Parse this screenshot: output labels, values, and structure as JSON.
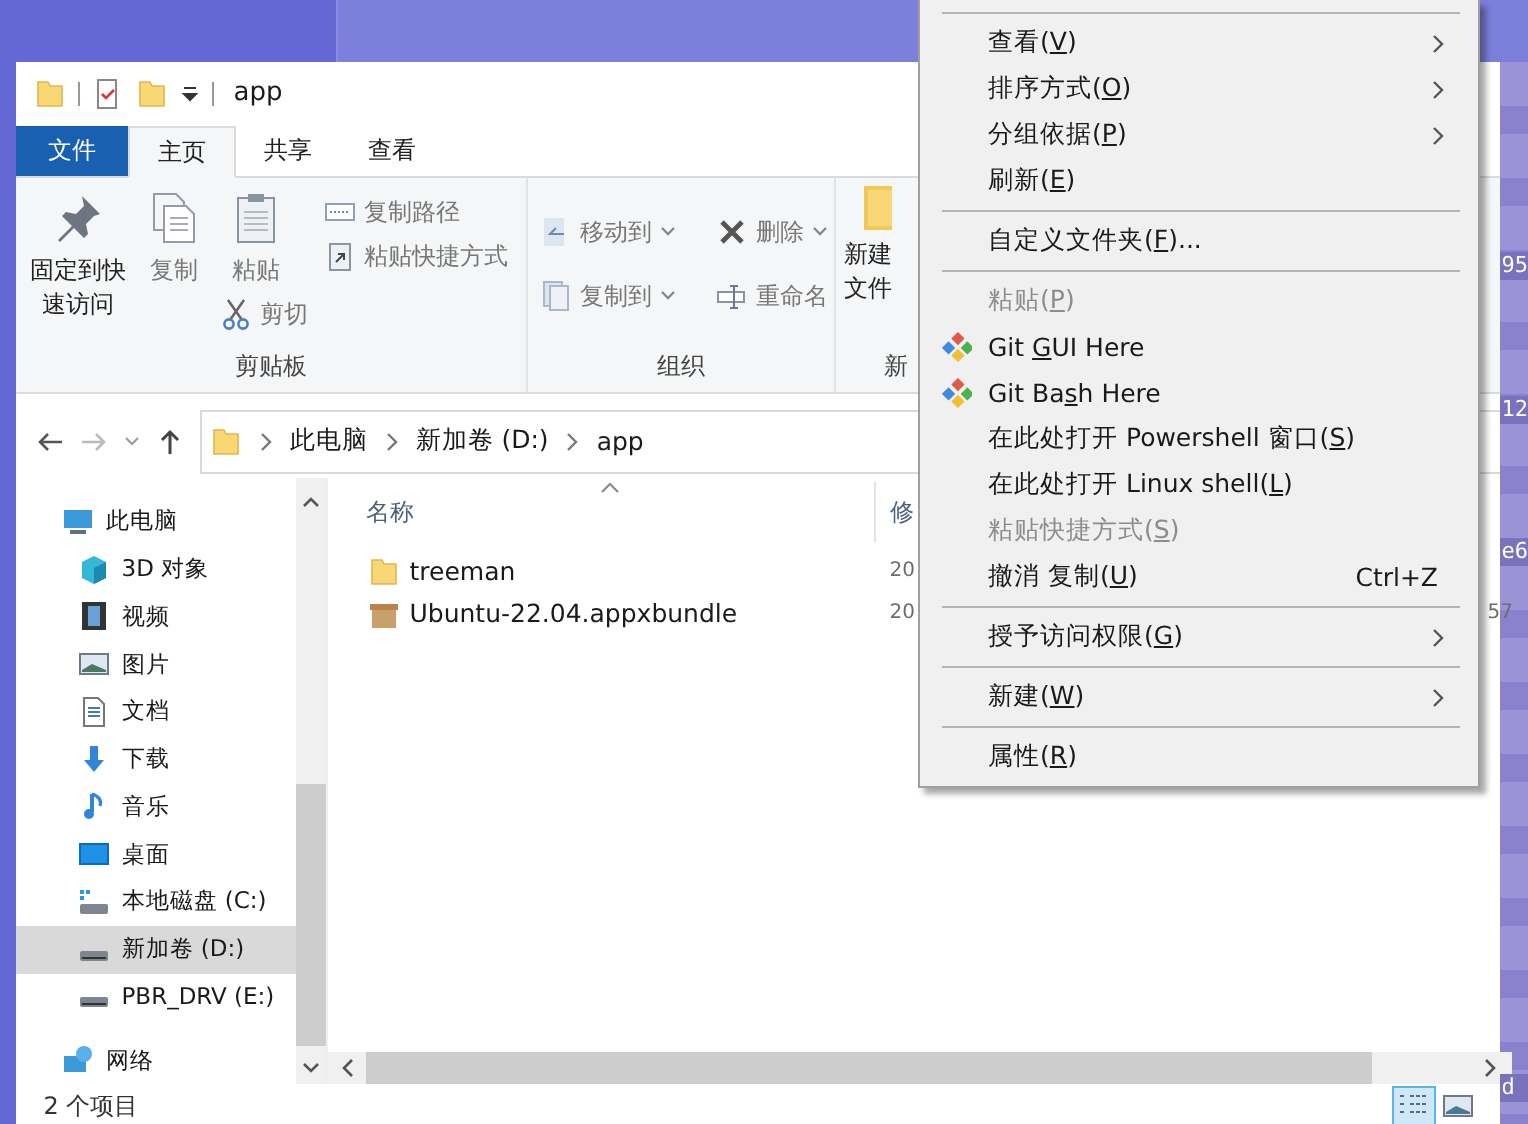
{
  "window": {
    "title": "app"
  },
  "tabs": [
    {
      "label": "文件",
      "kind": "file",
      "selected": false
    },
    {
      "label": "主页",
      "kind": "tab",
      "selected": true
    },
    {
      "label": "共享",
      "kind": "tab",
      "selected": false
    },
    {
      "label": "查看",
      "kind": "tab",
      "selected": false
    }
  ],
  "ribbon": {
    "groups": [
      {
        "label": "剪贴板",
        "buttons": [
          {
            "label": "固定到快速访问",
            "disabled": false
          },
          {
            "label": "复制",
            "disabled": true
          },
          {
            "label": "粘贴",
            "disabled": true
          },
          {
            "label": "复制路径",
            "disabled": true
          },
          {
            "label": "粘贴快捷方式",
            "disabled": true
          },
          {
            "label": "剪切",
            "disabled": true
          }
        ]
      },
      {
        "label": "组织",
        "buttons": [
          {
            "label": "移动到",
            "disabled": true
          },
          {
            "label": "复制到",
            "disabled": true
          },
          {
            "label": "删除",
            "disabled": true
          },
          {
            "label": "重命名",
            "disabled": true
          }
        ]
      },
      {
        "label": "新",
        "buttons": [
          {
            "label": "新建"
          },
          {
            "label": "文件"
          }
        ]
      }
    ]
  },
  "address": {
    "crumbs": [
      "此电脑",
      "新加卷 (D:)",
      "app"
    ]
  },
  "navigation": [
    {
      "label": "此电脑",
      "kind": "computer",
      "selected": false,
      "children": [
        {
          "label": "3D 对象",
          "kind": "cube",
          "selected": false
        },
        {
          "label": "视频",
          "kind": "film",
          "selected": false
        },
        {
          "label": "图片",
          "kind": "image",
          "selected": false
        },
        {
          "label": "文档",
          "kind": "document",
          "selected": false
        },
        {
          "label": "下载",
          "kind": "download",
          "selected": false
        },
        {
          "label": "音乐",
          "kind": "music",
          "selected": false
        },
        {
          "label": "桌面",
          "kind": "desktop",
          "selected": false
        },
        {
          "label": "本地磁盘 (C:)",
          "kind": "system-drive",
          "selected": false
        },
        {
          "label": "新加卷 (D:)",
          "kind": "drive",
          "selected": true
        },
        {
          "label": "PBR_DRV (E:)",
          "kind": "drive",
          "selected": false
        }
      ]
    },
    {
      "label": "网络",
      "kind": "network",
      "selected": false
    }
  ],
  "file_list": {
    "columns": [
      "名称",
      "修"
    ],
    "rows": [
      {
        "name": "treeman",
        "kind": "folder",
        "column_2": "20"
      },
      {
        "name": "Ubuntu-22.04.appxbundle",
        "kind": "package",
        "column_2": "20",
        "column_3": "57"
      }
    ]
  },
  "status_bar": {
    "item_count": "2 个项目"
  },
  "background_window": {
    "fragments": [
      "95",
      "12",
      "e6",
      "d"
    ]
  },
  "context_menu": [
    {
      "kind": "separator"
    },
    {
      "kind": "item",
      "before": "查看(",
      "key": "V",
      "after": ")",
      "disabled": false,
      "submenu": true
    },
    {
      "kind": "item",
      "before": "排序方式(",
      "key": "O",
      "after": ")",
      "disabled": false,
      "submenu": true
    },
    {
      "kind": "item",
      "before": "分组依据(",
      "key": "P",
      "after": ")",
      "disabled": false,
      "submenu": true
    },
    {
      "kind": "item",
      "before": "刷新(",
      "key": "E",
      "after": ")",
      "disabled": false,
      "submenu": false
    },
    {
      "kind": "separator"
    },
    {
      "kind": "item",
      "before": "自定义文件夹(",
      "key": "F",
      "after": ")...",
      "disabled": false,
      "submenu": false
    },
    {
      "kind": "separator"
    },
    {
      "kind": "item",
      "before": "粘贴(",
      "key": "P",
      "after": ")",
      "disabled": true,
      "submenu": false
    },
    {
      "kind": "git",
      "before": "Git ",
      "key": "G",
      "after": "UI Here",
      "disabled": false,
      "submenu": false
    },
    {
      "kind": "git",
      "before": "Git Ba",
      "key": "s",
      "after": "h Here",
      "disabled": false,
      "submenu": false
    },
    {
      "kind": "item",
      "before": "在此处打开 Powershell 窗口(",
      "key": "S",
      "after": ")",
      "disabled": false,
      "submenu": false
    },
    {
      "kind": "item",
      "before": "在此处打开 Linux shell(",
      "key": "L",
      "after": ")",
      "disabled": false,
      "submenu": false
    },
    {
      "kind": "item",
      "before": "粘贴快捷方式(",
      "key": "S",
      "after": ")",
      "disabled": true,
      "submenu": false
    },
    {
      "kind": "item",
      "before": "撤消 复制(",
      "key": "U",
      "after": ")",
      "disabled": false,
      "submenu": false,
      "shortcut": "Ctrl+Z"
    },
    {
      "kind": "separator"
    },
    {
      "kind": "item",
      "before": "授予访问权限(",
      "key": "G",
      "after": ")",
      "disabled": false,
      "submenu": true
    },
    {
      "kind": "separator"
    },
    {
      "kind": "item",
      "before": "新建(",
      "key": "W",
      "after": ")",
      "disabled": false,
      "submenu": true
    },
    {
      "kind": "separator"
    },
    {
      "kind": "item",
      "before": "属性(",
      "key": "R",
      "after": ")",
      "disabled": false,
      "submenu": false
    }
  ]
}
